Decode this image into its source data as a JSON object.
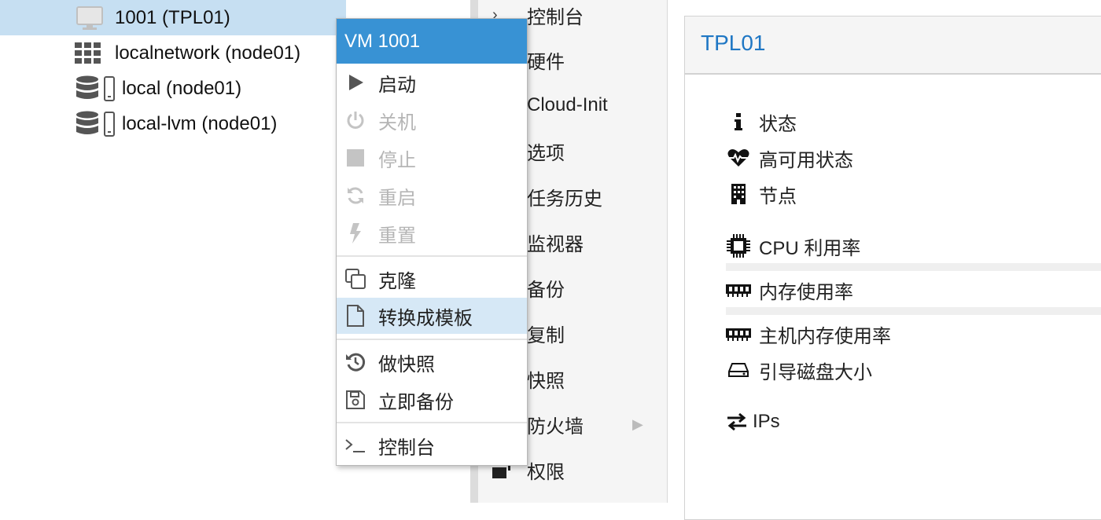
{
  "tree": {
    "items": [
      {
        "label": "1001 (TPL01)",
        "icon": "template-monitor-icon",
        "selected": true
      },
      {
        "label": "localnetwork (node01)",
        "icon": "network-grid-icon"
      },
      {
        "label": "local (node01)",
        "icon": "storage-icon"
      },
      {
        "label": "local-lvm (node01)",
        "icon": "storage-icon"
      }
    ]
  },
  "nav": {
    "items": [
      {
        "label": "控制台"
      },
      {
        "label": "硬件"
      },
      {
        "label": "Cloud-Init"
      },
      {
        "label": "选项"
      },
      {
        "label": "任务历史"
      },
      {
        "label": "监视器"
      },
      {
        "label": "备份"
      },
      {
        "label": "复制"
      },
      {
        "label": "快照"
      },
      {
        "label": "防火墙"
      },
      {
        "label": "权限"
      }
    ]
  },
  "panel": {
    "title": "TPL01",
    "status_rows": [
      {
        "label": "状态",
        "icon": "info-icon"
      },
      {
        "label": "高可用状态",
        "icon": "heartbeat-icon"
      },
      {
        "label": "节点",
        "icon": "building-icon"
      },
      {
        "label": "CPU 利用率",
        "icon": "cpu-icon"
      },
      {
        "label": "内存使用率",
        "icon": "memory-icon"
      },
      {
        "label": "主机内存使用率",
        "icon": "memory-icon"
      },
      {
        "label": "引导磁盘大小",
        "icon": "hdd-icon"
      },
      {
        "label": "IPs",
        "icon": "exchange-icon"
      }
    ]
  },
  "context_menu": {
    "title": "VM 1001",
    "items": [
      {
        "label": "启动",
        "icon": "play-icon",
        "disabled": false
      },
      {
        "label": "关机",
        "icon": "power-icon",
        "disabled": true
      },
      {
        "label": "停止",
        "icon": "stop-icon",
        "disabled": true
      },
      {
        "label": "重启",
        "icon": "refresh-icon",
        "disabled": true
      },
      {
        "label": "重置",
        "icon": "bolt-icon",
        "disabled": true
      },
      {
        "label": "克隆",
        "icon": "clone-icon",
        "disabled": false
      },
      {
        "label": "转换成模板",
        "icon": "file-icon",
        "disabled": false,
        "hover": true
      },
      {
        "label": "做快照",
        "icon": "history-icon",
        "disabled": false
      },
      {
        "label": "立即备份",
        "icon": "save-icon",
        "disabled": false
      },
      {
        "label": "控制台",
        "icon": "terminal-icon",
        "disabled": false
      }
    ]
  },
  "colors": {
    "accent": "#3892d4",
    "selection": "#c6dff2",
    "menu_hover": "#d6e8f6",
    "title_blue": "#1f77c4",
    "disabled_text": "#b5b5b5"
  }
}
